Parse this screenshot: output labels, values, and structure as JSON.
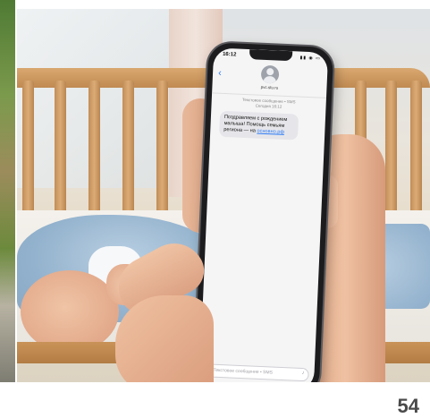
{
  "phone": {
    "status_time": "16:12",
    "status_icons": "▮▮ ◉ ▭",
    "contact": "pvc.stu.ru",
    "meta_line1": "Текстовое сообщение • SMS",
    "meta_line2": "Сегодня 16:12",
    "message_text": "Поздравляем с рождением малыша! Помощь семьям региона — на",
    "message_link": "основно.рф",
    "input_placeholder": "Текстовое сообщение • SMS"
  },
  "page_number": "54",
  "colors": {
    "link": "#2f7cf6",
    "bubble": "#e6e6ea",
    "crib_wood": "#c99358",
    "blanket": "#93b2cd"
  }
}
